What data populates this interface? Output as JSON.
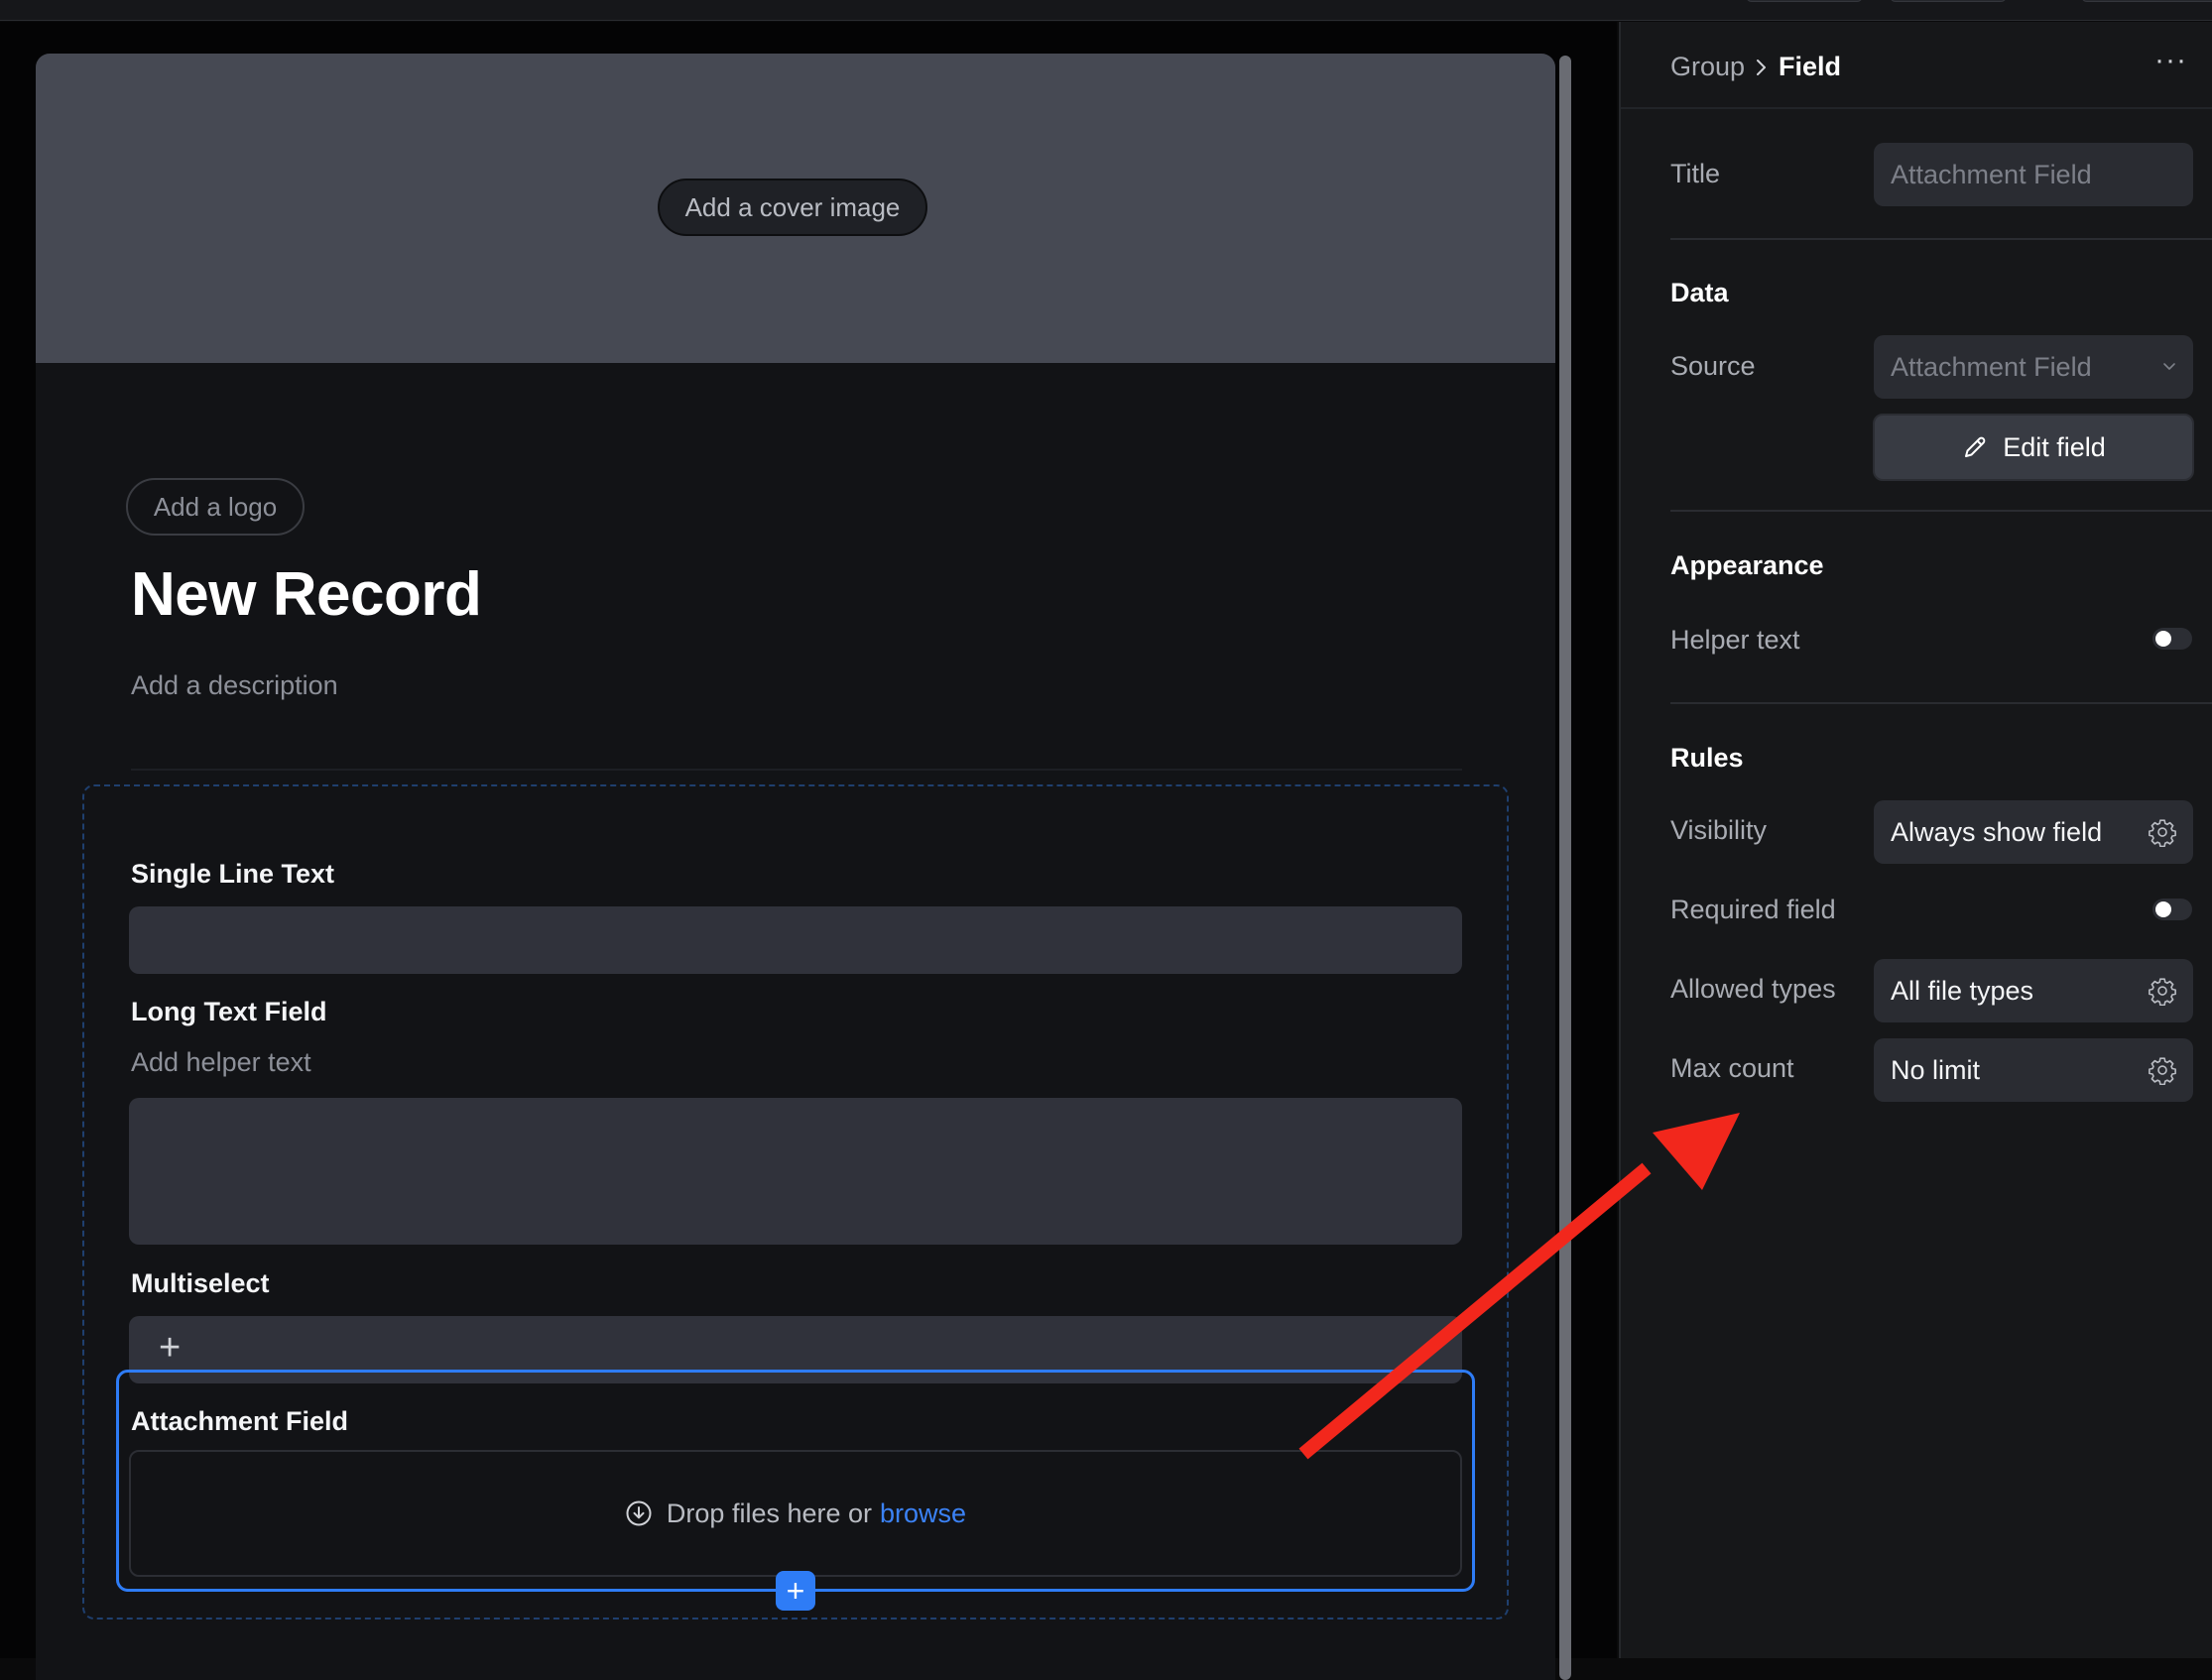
{
  "form": {
    "cover_button": "Add a cover image",
    "logo_button": "Add a logo",
    "title": "New Record",
    "description": "Add a description",
    "fields": {
      "single_line": {
        "label": "Single Line Text"
      },
      "long_text": {
        "label": "Long Text Field",
        "helper": "Add helper text"
      },
      "multiselect": {
        "label": "Multiselect",
        "add_glyph": "+"
      },
      "attachment": {
        "label": "Attachment Field",
        "drop_text": "Drop files here or",
        "browse_link": "browse"
      }
    },
    "add_field_glyph": "+"
  },
  "panel": {
    "breadcrumb": {
      "parent": "Group",
      "separator": "›",
      "current": "Field"
    },
    "more_glyph": "···",
    "title_row": {
      "label": "Title",
      "placeholder": "Attachment Field"
    },
    "data": {
      "heading": "Data",
      "source_label": "Source",
      "source_value": "Attachment Field",
      "edit_button": "Edit field"
    },
    "appearance": {
      "heading": "Appearance",
      "helper_text_label": "Helper text",
      "helper_text_on": false
    },
    "rules": {
      "heading": "Rules",
      "visibility_label": "Visibility",
      "visibility_value": "Always show field",
      "required_label": "Required field",
      "required_on": false,
      "allowed_types_label": "Allowed types",
      "allowed_types_value": "All file types",
      "max_count_label": "Max count",
      "max_count_value": "No limit"
    }
  },
  "colors": {
    "accent_blue": "#2e7cf6",
    "annotation_red": "#f2271c"
  }
}
